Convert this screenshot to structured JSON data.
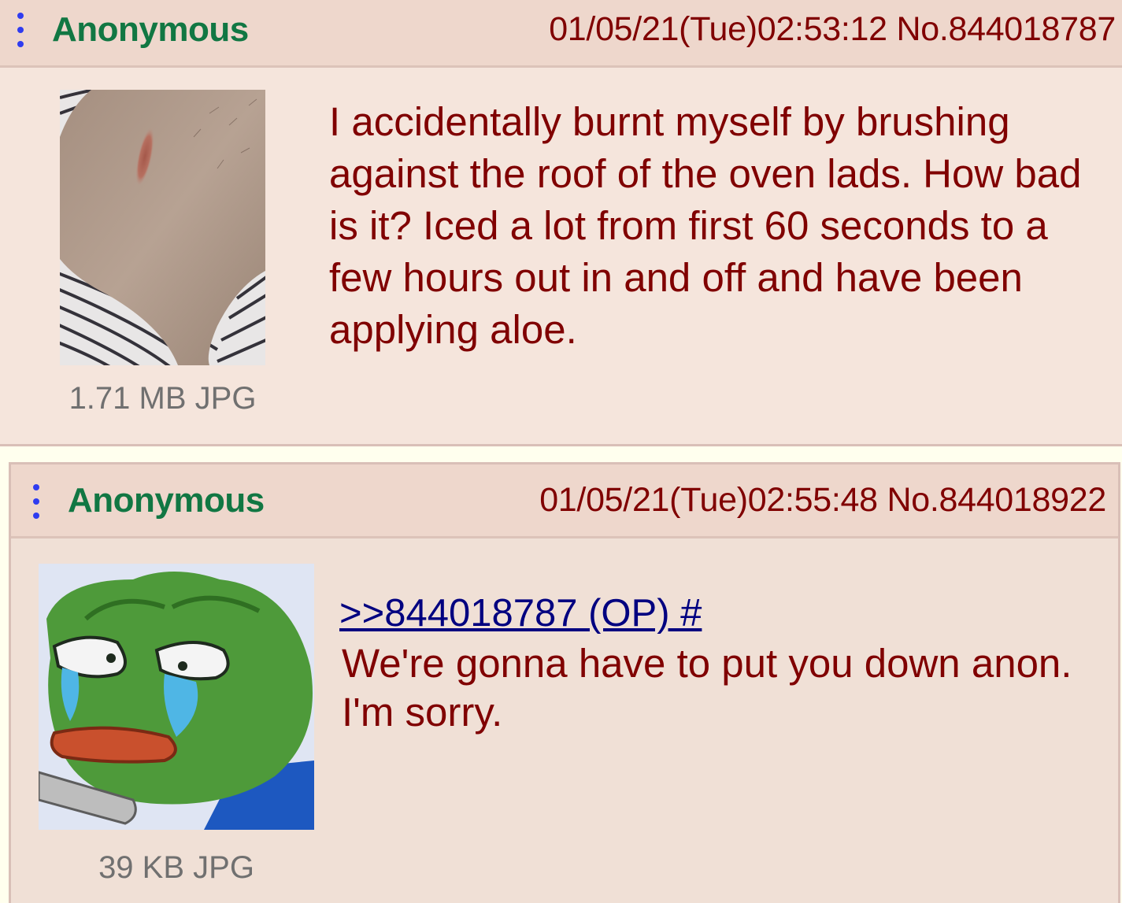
{
  "posts": [
    {
      "name": "Anonymous",
      "datetime": "01/05/21(Tue)02:53:12",
      "number": "No.844018787",
      "file_info": "1.71 MB JPG",
      "image_icon": "burn-photo-thumbnail",
      "body": "I accidentally burnt myself by brushing against the roof of the oven lads. How bad is it? Iced a lot from first 60 seconds to a few hours out in and off and have been applying aloe."
    },
    {
      "name": "Anonymous",
      "datetime": "01/05/21(Tue)02:55:48",
      "number": "No.844018922",
      "file_info": "39 KB JPG",
      "image_icon": "crying-frog-thumbnail",
      "quote_link": ">>844018787 (OP) #",
      "body": "We're gonna have to put you down anon.\nI'm sorry."
    }
  ],
  "colors": {
    "page_background": "#ffffee",
    "op_background": "#f5e5dc",
    "reply_background": "#f0e0d6",
    "header_background": "#eed7cc",
    "name": "#117743",
    "text": "#800000",
    "quote_link": "#000080",
    "file_info": "#707070",
    "menu_dots": "#2f3cf0"
  }
}
